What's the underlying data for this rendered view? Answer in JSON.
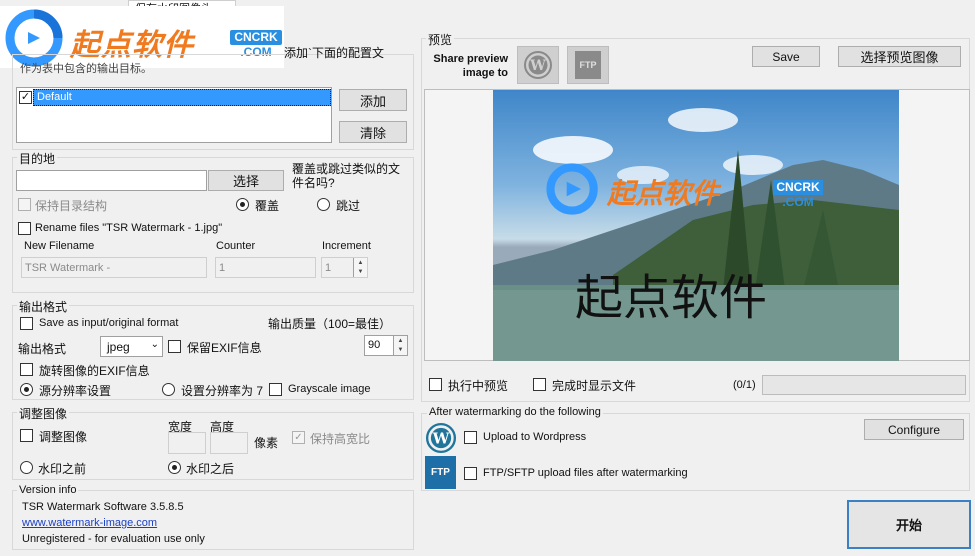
{
  "logo": {
    "brand_text": "起点软件",
    "badge_top": "CNCRK",
    "badge_bottom": ".COM"
  },
  "top_tab": {
    "label": "保存水印图像头"
  },
  "targets": {
    "hint_right": "添加`下面的配置文",
    "hint_left": "作为表中包含的输出目标。",
    "list": [
      {
        "label": "Default",
        "checked": true
      }
    ],
    "add_label": "添加",
    "clear_label": "清除"
  },
  "destination": {
    "title": "目的地",
    "choose_label": "选择",
    "overwrite_question": "覆盖或跳过类似的文件名吗?",
    "keep_structure_label": "保持目录结构",
    "overwrite_label": "覆盖",
    "skip_label": "跳过",
    "rename_label": "Rename files \"TSR Watermark - 1.jpg\"",
    "new_filename_header": "New Filename",
    "counter_header": "Counter",
    "increment_header": "Increment",
    "new_filename_value": "TSR Watermark -",
    "counter_value": "1",
    "increment_value": "1"
  },
  "output_format": {
    "title": "输出格式",
    "save_as_input_label": "Save as input/original format",
    "quality_label": "输出质量（100=最佳）",
    "format_label": "输出格式",
    "format_value": "jpeg",
    "keep_exif_label": "保留EXIF信息",
    "quality_value": "90",
    "rotate_exif_label": "旋转图像的EXIF信息",
    "source_resolution_label": "源分辨率设置",
    "set_resolution_label": "设置分辨率为 7",
    "grayscale_label": "Grayscale image"
  },
  "resize": {
    "title": "调整图像",
    "width_header": "宽度",
    "height_header": "高度",
    "resize_label": "调整图像",
    "pixels_label": "像素",
    "keep_ratio_label": "保持高宽比",
    "before_label": "水印之前",
    "after_label": "水印之后"
  },
  "version": {
    "title": "Version info",
    "line1": "TSR Watermark Software 3.5.8.5",
    "link": "www.watermark-image.com",
    "line3": "Unregistered - for evaluation use only"
  },
  "preview": {
    "title": "预览",
    "share_label": "Share preview image to",
    "ftp_icon_text": "FTP",
    "save_label": "Save",
    "choose_preview_label": "选择预览图像",
    "watermark_text": "起点软件",
    "preview_running_label": "执行中预览",
    "show_when_done_label": "完成时显示文件",
    "progress_text": "(0/1)",
    "progress_fraction": 0
  },
  "after": {
    "title": "After watermarking do the following",
    "wordpress_label": "Upload to Wordpress",
    "configure_label": "Configure",
    "ftp_label": "FTP/SFTP upload files after watermarking",
    "ftp_icon_text": "FTP"
  },
  "start_label": "开始",
  "colors": {
    "accent_blue": "#3399ff",
    "logo_orange": "#f07a1f",
    "wp_blue": "#21759b",
    "list_select": "#3399ff"
  }
}
